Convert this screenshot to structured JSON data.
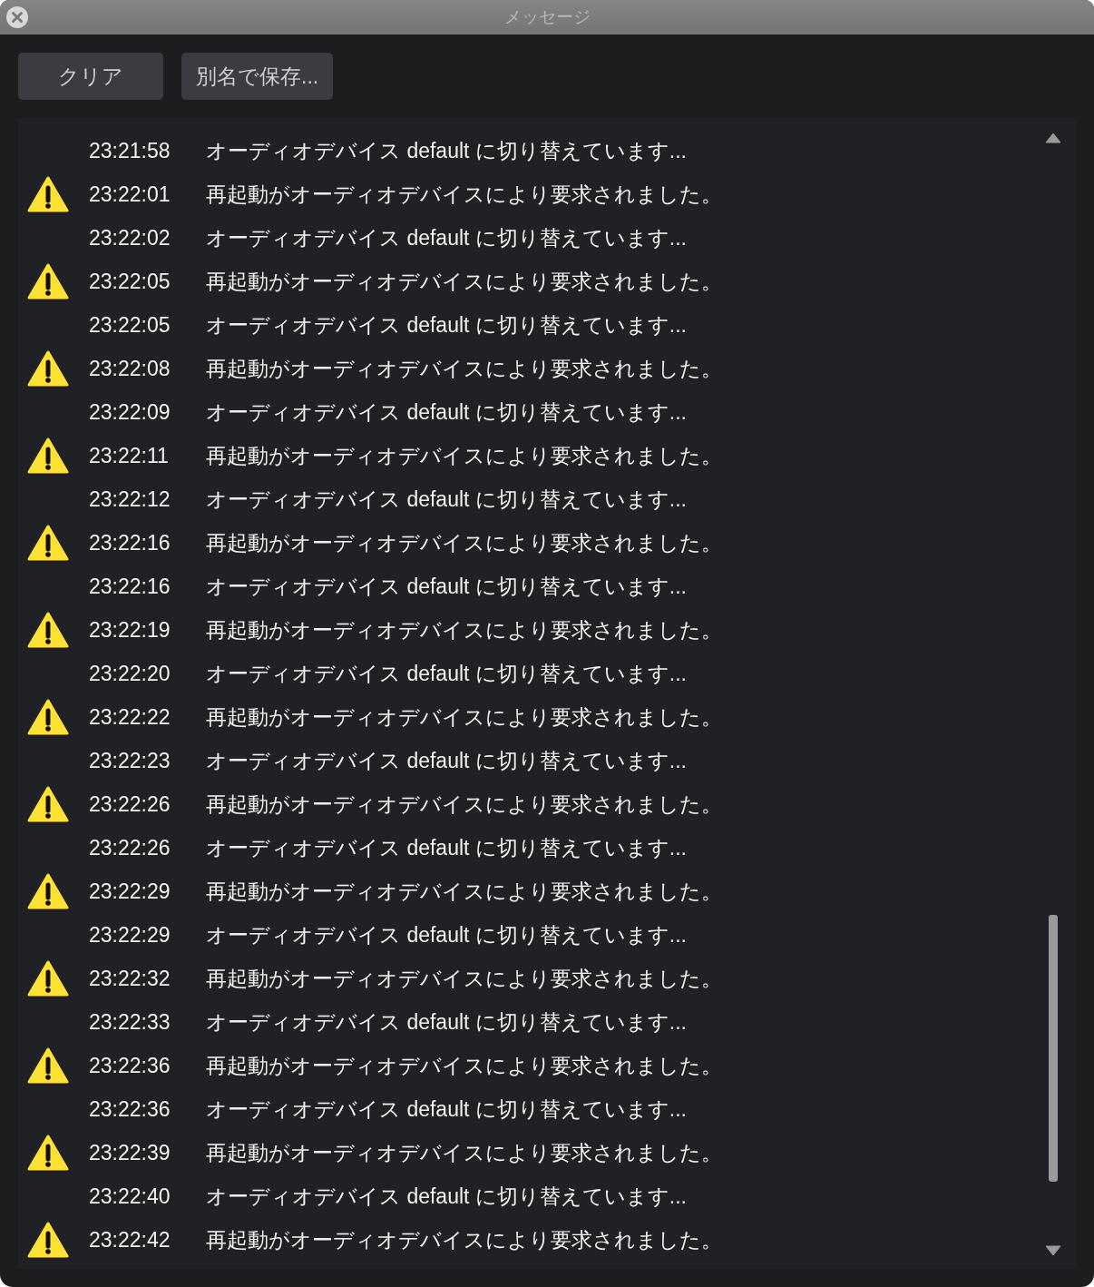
{
  "window": {
    "title": "メッセージ"
  },
  "buttons": [
    "クリア",
    "別名で保存..."
  ],
  "messages": [
    {
      "kind": "info",
      "time": "23:21:58",
      "text": "オーディオデバイス default に切り替えています..."
    },
    {
      "kind": "warning",
      "time": "23:22:01",
      "text": "再起動がオーディオデバイスにより要求されました。"
    },
    {
      "kind": "info",
      "time": "23:22:02",
      "text": "オーディオデバイス default に切り替えています..."
    },
    {
      "kind": "warning",
      "time": "23:22:05",
      "text": "再起動がオーディオデバイスにより要求されました。"
    },
    {
      "kind": "info",
      "time": "23:22:05",
      "text": "オーディオデバイス default に切り替えています..."
    },
    {
      "kind": "warning",
      "time": "23:22:08",
      "text": "再起動がオーディオデバイスにより要求されました。"
    },
    {
      "kind": "info",
      "time": "23:22:09",
      "text": "オーディオデバイス default に切り替えています..."
    },
    {
      "kind": "warning",
      "time": "23:22:11",
      "text": "再起動がオーディオデバイスにより要求されました。"
    },
    {
      "kind": "info",
      "time": "23:22:12",
      "text": "オーディオデバイス default に切り替えています..."
    },
    {
      "kind": "warning",
      "time": "23:22:16",
      "text": "再起動がオーディオデバイスにより要求されました。"
    },
    {
      "kind": "info",
      "time": "23:22:16",
      "text": "オーディオデバイス default に切り替えています..."
    },
    {
      "kind": "warning",
      "time": "23:22:19",
      "text": "再起動がオーディオデバイスにより要求されました。"
    },
    {
      "kind": "info",
      "time": "23:22:20",
      "text": "オーディオデバイス default に切り替えています..."
    },
    {
      "kind": "warning",
      "time": "23:22:22",
      "text": "再起動がオーディオデバイスにより要求されました。"
    },
    {
      "kind": "info",
      "time": "23:22:23",
      "text": "オーディオデバイス default に切り替えています..."
    },
    {
      "kind": "warning",
      "time": "23:22:26",
      "text": "再起動がオーディオデバイスにより要求されました。"
    },
    {
      "kind": "info",
      "time": "23:22:26",
      "text": "オーディオデバイス default に切り替えています..."
    },
    {
      "kind": "warning",
      "time": "23:22:29",
      "text": "再起動がオーディオデバイスにより要求されました。"
    },
    {
      "kind": "info",
      "time": "23:22:29",
      "text": "オーディオデバイス default に切り替えています..."
    },
    {
      "kind": "warning",
      "time": "23:22:32",
      "text": "再起動がオーディオデバイスにより要求されました。"
    },
    {
      "kind": "info",
      "time": "23:22:33",
      "text": "オーディオデバイス default に切り替えています..."
    },
    {
      "kind": "warning",
      "time": "23:22:36",
      "text": "再起動がオーディオデバイスにより要求されました。"
    },
    {
      "kind": "info",
      "time": "23:22:36",
      "text": "オーディオデバイス default に切り替えています..."
    },
    {
      "kind": "warning",
      "time": "23:22:39",
      "text": "再起動がオーディオデバイスにより要求されました。"
    },
    {
      "kind": "info",
      "time": "23:22:40",
      "text": "オーディオデバイス default に切り替えています..."
    },
    {
      "kind": "warning",
      "time": "23:22:42",
      "text": "再起動がオーディオデバイスにより要求されました。"
    }
  ]
}
